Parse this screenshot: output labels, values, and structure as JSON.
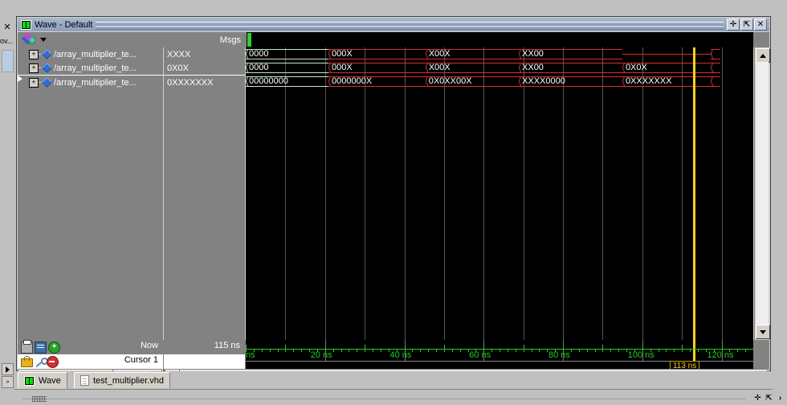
{
  "window": {
    "title": "Wave - Default",
    "icon": "wave-window-icon",
    "buttons": [
      {
        "name": "undock-button",
        "glyph": "✛"
      },
      {
        "name": "maximize-button",
        "glyph": "⇱"
      },
      {
        "name": "close-button",
        "glyph": "✕"
      }
    ]
  },
  "left_dock": {
    "close_glyph": "✕",
    "label": "ov...",
    "scroll_right_glyph": "▶",
    "expand_glyph": "»"
  },
  "header": {
    "object_menu_icon": "objects-gem-icon",
    "dropdown_caret": "chevron-down-icon",
    "messages_column": "Msgs"
  },
  "signals": [
    {
      "name": "/array_multiplier_te...",
      "value": "XXXX",
      "expand": "+",
      "icon": "signal-diamond-icon"
    },
    {
      "name": "/array_multiplier_te...",
      "value": "0X0X",
      "expand": "+",
      "icon": "signal-diamond-icon"
    },
    {
      "name": "/array_multiplier_te...",
      "value": "0XXXXXXX",
      "expand": "+",
      "icon": "signal-diamond-icon"
    }
  ],
  "waves": [
    {
      "row": 0,
      "segments": [
        {
          "label": "0000",
          "start_pct": 0.0,
          "end_pct": 16.3,
          "state": "defined"
        },
        {
          "label": "000X",
          "start_pct": 16.3,
          "end_pct": 35.4,
          "state": "unknown"
        },
        {
          "label": "X00X",
          "start_pct": 35.4,
          "end_pct": 53.8,
          "state": "unknown"
        },
        {
          "label": "XX00",
          "start_pct": 53.8,
          "end_pct": 74.2,
          "state": "unknown"
        },
        {
          "label": "",
          "start_pct": 74.2,
          "end_pct": 91.6,
          "state": "collapsed"
        },
        {
          "label": "",
          "start_pct": 91.6,
          "end_pct": 93.5,
          "state": "unknown"
        }
      ]
    },
    {
      "row": 1,
      "segments": [
        {
          "label": "0000",
          "start_pct": 0.0,
          "end_pct": 16.3,
          "state": "defined"
        },
        {
          "label": "000X",
          "start_pct": 16.3,
          "end_pct": 35.4,
          "state": "unknown"
        },
        {
          "label": "X00X",
          "start_pct": 35.4,
          "end_pct": 53.8,
          "state": "unknown"
        },
        {
          "label": "XX00",
          "start_pct": 53.8,
          "end_pct": 74.2,
          "state": "unknown"
        },
        {
          "label": "0X0X",
          "start_pct": 74.2,
          "end_pct": 91.6,
          "state": "unknown"
        },
        {
          "label": "",
          "start_pct": 91.6,
          "end_pct": 93.5,
          "state": "unknown"
        }
      ]
    },
    {
      "row": 2,
      "segments": [
        {
          "label": "00000000",
          "start_pct": 0.0,
          "end_pct": 16.3,
          "state": "defined"
        },
        {
          "label": "0000000X",
          "start_pct": 16.3,
          "end_pct": 35.4,
          "state": "unknown"
        },
        {
          "label": "0X0XX00X",
          "start_pct": 35.4,
          "end_pct": 53.8,
          "state": "unknown"
        },
        {
          "label": "XXXX0000",
          "start_pct": 53.8,
          "end_pct": 74.2,
          "state": "unknown"
        },
        {
          "label": "0XXXXXXX",
          "start_pct": 74.2,
          "end_pct": 91.6,
          "state": "unknown"
        },
        {
          "label": "",
          "start_pct": 91.6,
          "end_pct": 93.5,
          "state": "unknown"
        }
      ]
    }
  ],
  "timeline": {
    "unit": "ns",
    "start_label": "ns",
    "labels": [
      "20 ns",
      "40 ns",
      "60 ns",
      "80 ns",
      "100 ns",
      "120 ns"
    ],
    "label_values": [
      20,
      40,
      60,
      80,
      100,
      120
    ],
    "range_start": 0,
    "range_end": 128,
    "minor_tick_ns": 2,
    "major_tick_ns": 10
  },
  "cursor_panel": {
    "now_label": "Now",
    "now_value": "115 ns",
    "cursor_label": "Cursor 1",
    "cursor_value": "113 ns",
    "cursor_flag": "113 ns",
    "cursor_time_ns": 113,
    "icons": [
      {
        "name": "print-icon"
      },
      {
        "name": "annotation-icon"
      },
      {
        "name": "add-cursor-icon"
      },
      {
        "name": "lock-cursor-icon"
      },
      {
        "name": "configure-cursor-icon"
      },
      {
        "name": "delete-cursor-icon"
      }
    ]
  },
  "scrollbars": {
    "left_arrow": "◀",
    "right_arrow": "▶",
    "up_arrow": "▲",
    "down_arrow": "▼"
  },
  "tabs": [
    {
      "label": "Wave",
      "icon": "wave-tab-icon",
      "active": true
    },
    {
      "label": "test_multiplier.vhd",
      "icon": "document-tab-icon",
      "active": false
    }
  ],
  "status_strip": {
    "buttons": [
      {
        "name": "status-undock-button",
        "glyph": "✛"
      },
      {
        "name": "status-maximize-button",
        "glyph": "⇱"
      },
      {
        "name": "status-close-button",
        "glyph": "›"
      }
    ]
  },
  "colors": {
    "defined": "#c8e6c8",
    "unknown": "#d83030",
    "cursor": "#ffd21e",
    "timeline": "#22cc22",
    "panel": "#828282",
    "wave_bg": "#000000"
  }
}
